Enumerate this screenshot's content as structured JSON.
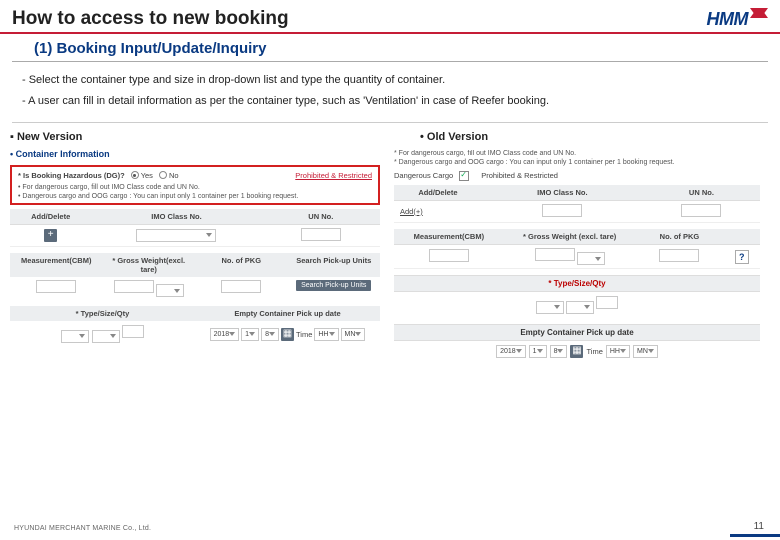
{
  "header": {
    "title": "How to access to new booking",
    "logo": "HMM"
  },
  "subtitle": "(1) Booking Input/Update/Inquiry",
  "bullets": {
    "b1": "- Select the container type and size in drop-down list and type the quantity of container.",
    "b2": "- A user can fill in detail information as per the container type, such as 'Ventilation' in case of Reefer booking."
  },
  "new": {
    "label": "▪ New Version",
    "section": "• Container Information",
    "hazQ": "* Is Booking Hazardous (DG)?",
    "yes": "Yes",
    "no": "No",
    "link": "Prohibited & Restricted",
    "note1": "• For dangerous cargo, fill out IMO Class code and UN No.",
    "note2": "• Dangerous cargo and OOG cargo : You can input only 1 container per 1 booking request.",
    "th_add": "Add/Delete",
    "th_imo": "IMO Class No.",
    "th_un": "UN No.",
    "plus": "+",
    "m_cbm": "Measurement(CBM)",
    "m_gw": "* Gross Weight(excl. tare)",
    "m_pkg": "No. of PKG",
    "m_search": "Search Pick-up Units",
    "m_type": "* Type/Size/Qty",
    "m_empty": "Empty Container Pick up date",
    "year": "2018",
    "mon": "1",
    "day": "8",
    "time": "Time",
    "hh": "HH",
    "mn": "MN"
  },
  "old": {
    "label": "• Old Version",
    "note1": "* For dangerous cargo, fill out IMO Class code and UN No.",
    "note2": "* Dangerous cargo and OOG cargo : You can input only 1 container per 1 booking request.",
    "dg": "Dangerous Cargo",
    "pr": "Prohibited & Restricted",
    "th_add": "Add/Delete",
    "th_imo": "IMO Class No.",
    "th_un": "UN No.",
    "addplus": "Add(+)",
    "m_cbm": "Measurement(CBM)",
    "m_gw": "* Gross Weight (excl. tare)",
    "m_pkg": "No. of PKG",
    "q": "?",
    "r_type": "* Type/Size/Qty",
    "r_empty": "Empty Container Pick up date",
    "year": "2018",
    "mon": "1",
    "day": "8",
    "time": "Time",
    "hh": "HH",
    "mn": "MN"
  },
  "footer": {
    "co": "HYUNDAI MERCHANT MARINE Co., Ltd.",
    "page": "11"
  }
}
